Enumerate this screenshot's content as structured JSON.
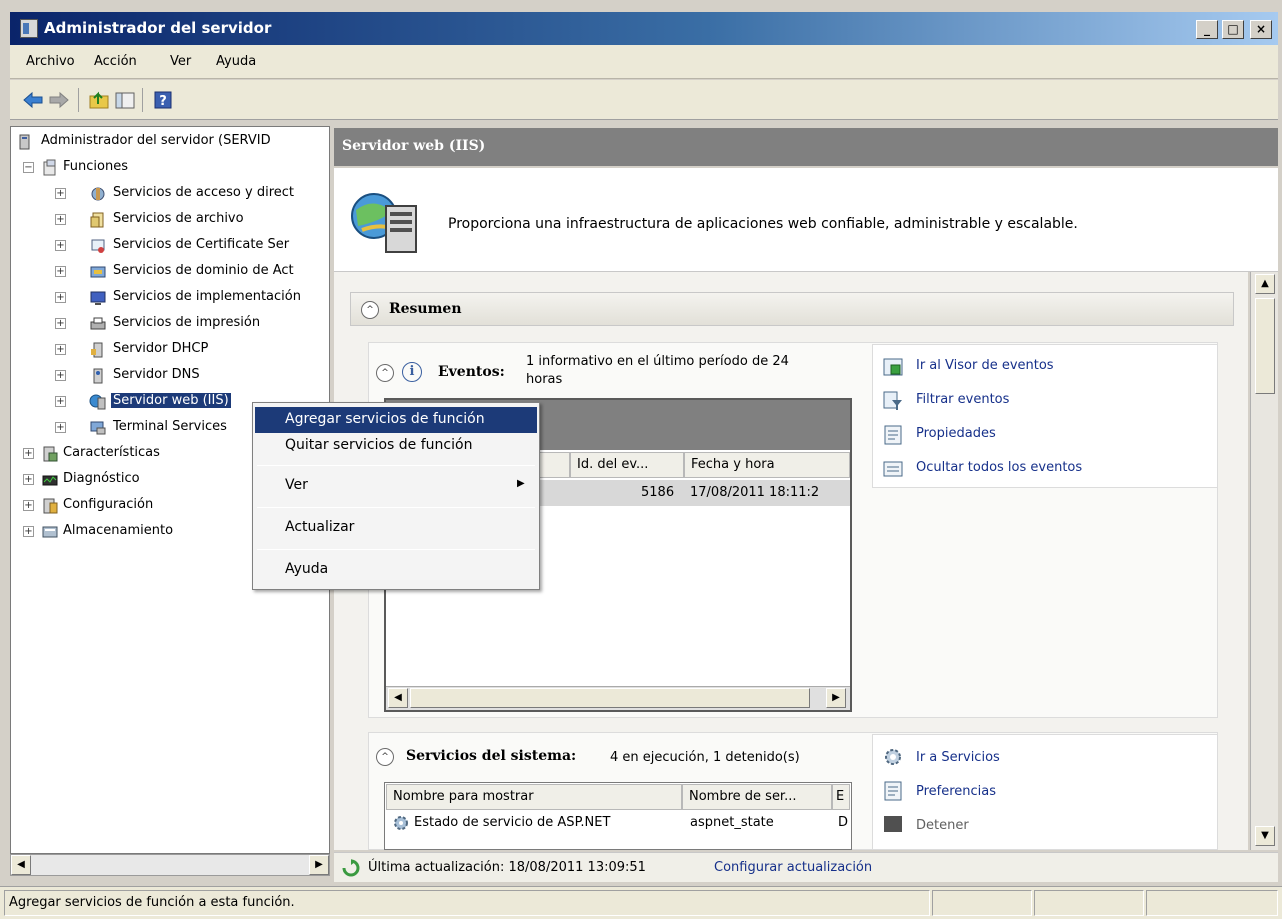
{
  "window": {
    "title": "Administrador del servidor"
  },
  "menu": [
    "Archivo",
    "Acción",
    "Ver",
    "Ayuda"
  ],
  "tree": {
    "root": "Administrador del servidor (SERVID",
    "funciones": "Funciones",
    "roles": [
      "Servicios de acceso y direct",
      "Servicios de archivo",
      "Servicios de Certificate Ser",
      "Servicios de dominio de Act",
      "Servicios de implementación",
      "Servicios de impresión",
      "Servidor DHCP",
      "Servidor DNS",
      "Servidor web (IIS)",
      "Terminal Services"
    ],
    "others": [
      "Características",
      "Diagnóstico",
      "Configuración",
      "Almacenamiento"
    ]
  },
  "context_menu": {
    "items": [
      "Agregar servicios de función",
      "Quitar servicios de función",
      "Ver",
      "Actualizar",
      "Ayuda"
    ],
    "submenu_arrow": "▶"
  },
  "right_panel": {
    "header": "Servidor web (IIS)",
    "description": "Proporciona una infraestructura de aplicaciones web confiable, administrable y escalable.",
    "resumen": "Resumen",
    "events": {
      "title": "Eventos:",
      "summary_line1": "1 informativo en el último período de 24",
      "summary_line2": "horas",
      "columns": [
        "Id. del ev...",
        "Fecha y hora"
      ],
      "row": {
        "id": "5186",
        "date": "17/08/2011 18:11:2"
      },
      "links": [
        "Ir al Visor de eventos",
        "Filtrar eventos",
        "Propiedades",
        "Ocultar todos los eventos"
      ]
    },
    "services": {
      "title": "Servicios del sistema:",
      "summary": "4 en ejecución, 1 detenido(s)",
      "columns": [
        "Nombre para mostrar",
        "Nombre de ser...",
        "E"
      ],
      "rows": [
        {
          "display": "Estado de servicio de ASP.NET",
          "name": "aspnet_state",
          "e": "D"
        }
      ],
      "links": [
        "Ir a Servicios",
        "Preferencias",
        "Detener"
      ]
    },
    "bottom": {
      "last_update": "Última actualización: 18/08/2011 13:09:51",
      "configure_link": "Configurar actualización"
    }
  },
  "statusbar": {
    "text": "Agregar servicios de función a esta función."
  },
  "caption_buttons": {
    "minimize": "_",
    "maximize": "□",
    "close": "×"
  },
  "glyphs": {
    "expand": "+",
    "collapse": "−",
    "collapse_up": "^",
    "info": "i",
    "arrow_left": "◀",
    "arrow_right": "▶",
    "arrow_up": "▲",
    "arrow_down": "▼"
  }
}
